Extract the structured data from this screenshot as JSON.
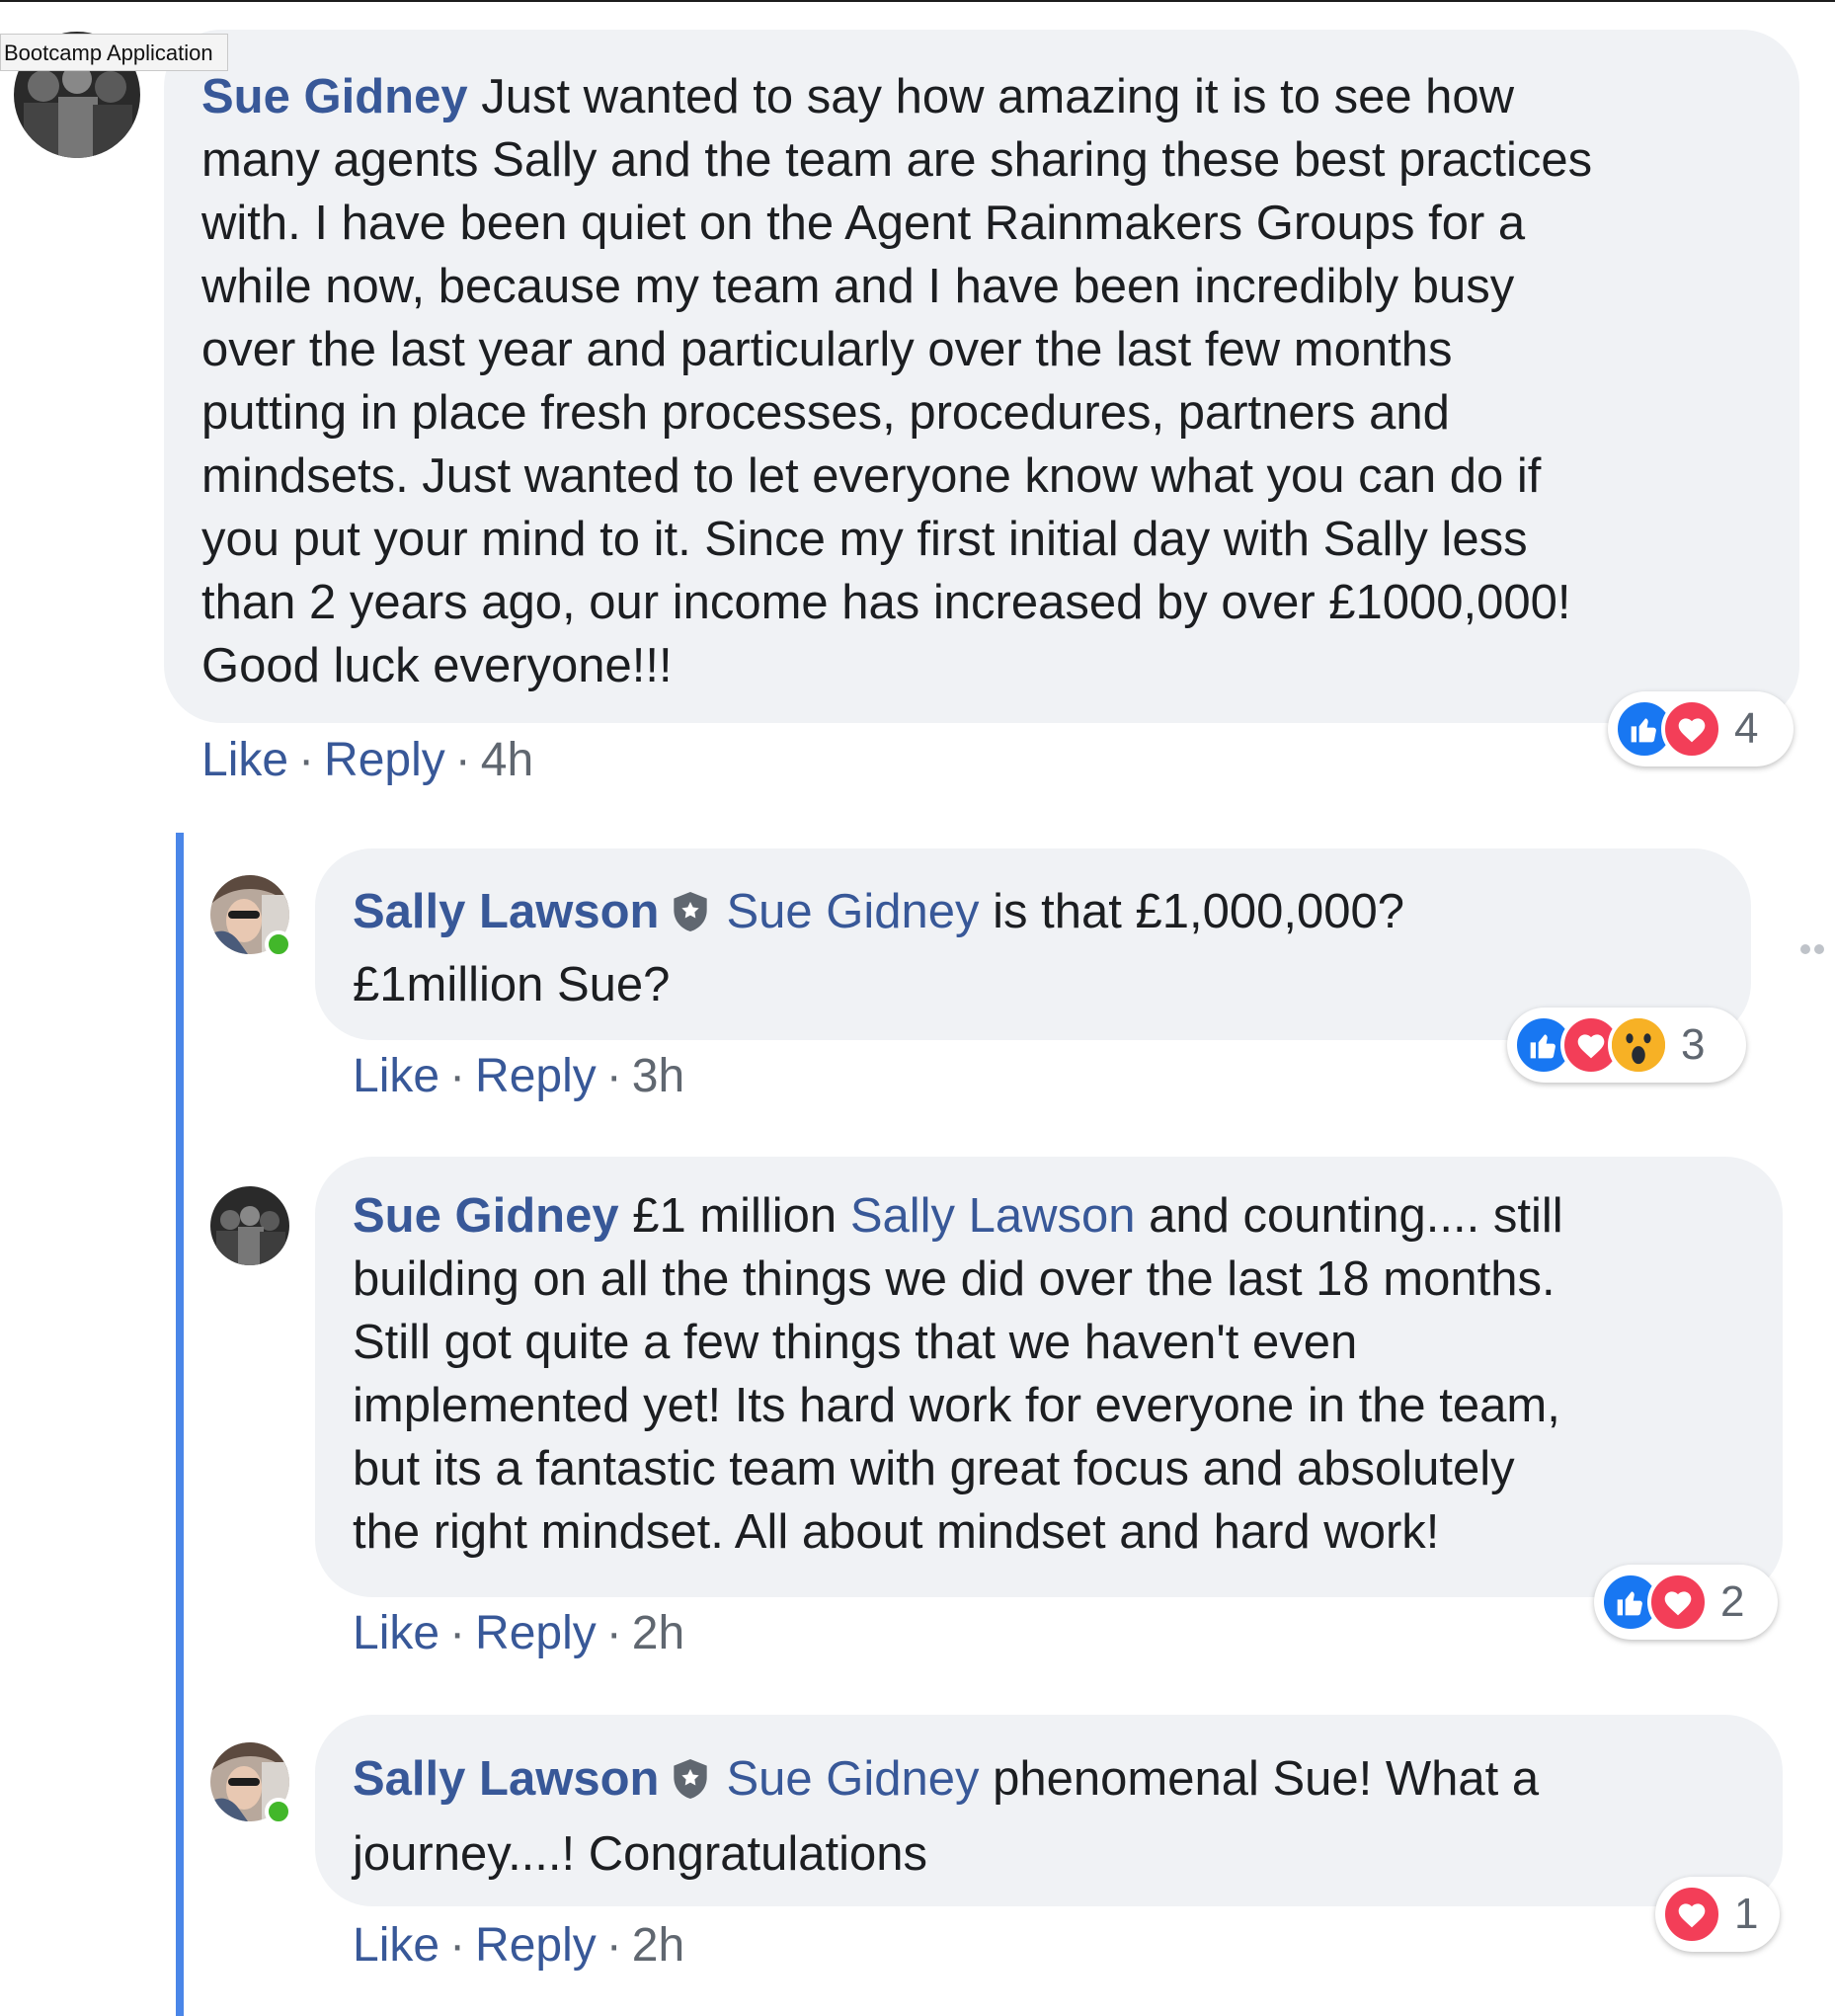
{
  "tooltip": "Bootcamp Application",
  "colors": {
    "link": "#385898",
    "bubble": "#f0f2f5",
    "thread_line": "#4a86e8",
    "like": "#1877f2",
    "love": "#f33e58",
    "wow": "#f7b125",
    "online": "#42b72a"
  },
  "comments": [
    {
      "author": "Sue Gidney",
      "lines": [
        "Just wanted to say how amazing it is to see how",
        "many agents Sally and the team are sharing these best practices",
        "with. I have been quiet on the Agent Rainmakers Groups for a",
        "while now, because my team and I have been incredibly busy",
        "over the last year and particularly over the last few months",
        "putting in place fresh processes, procedures, partners and",
        "mindsets. Just wanted to let everyone know what you can do if",
        "you put your mind to it. Since my first initial day with Sally less",
        "than 2 years ago, our income has increased by over £1000,000!",
        "Good luck everyone!!!"
      ],
      "like_label": "Like",
      "reply_label": "Reply",
      "time": "4h",
      "reactions": [
        "like-icon",
        "love-icon"
      ],
      "reaction_count": "4"
    }
  ],
  "replies": [
    {
      "author": "Sally Lawson",
      "mention": "Sue Gidney",
      "text_line1": "is that £1,000,000?",
      "text_line2": "£1million Sue?",
      "like_label": "Like",
      "reply_label": "Reply",
      "time": "3h",
      "reactions": [
        "like-icon",
        "love-icon",
        "wow-icon"
      ],
      "reaction_count": "3"
    },
    {
      "author": "Sue Gidney",
      "text_pre": "£1 million",
      "mention": "Sally Lawson",
      "text_post": "and counting.... still",
      "lines": [
        "building on all the things we did over the last 18 months.",
        "Still got quite a few things that we haven't even",
        "implemented yet! Its hard work for everyone in the team,",
        "but its a fantastic team with great focus and absolutely",
        "the right mindset. All about mindset and hard work!"
      ],
      "like_label": "Like",
      "reply_label": "Reply",
      "time": "2h",
      "reactions": [
        "like-icon",
        "love-icon"
      ],
      "reaction_count": "2"
    },
    {
      "author": "Sally Lawson",
      "mention": "Sue Gidney",
      "text_line1": "phenomenal Sue! What a",
      "text_line2": "journey....! Congratulations",
      "like_label": "Like",
      "reply_label": "Reply",
      "time": "2h",
      "reactions": [
        "love-icon"
      ],
      "reaction_count": "1"
    }
  ],
  "separator": "·"
}
